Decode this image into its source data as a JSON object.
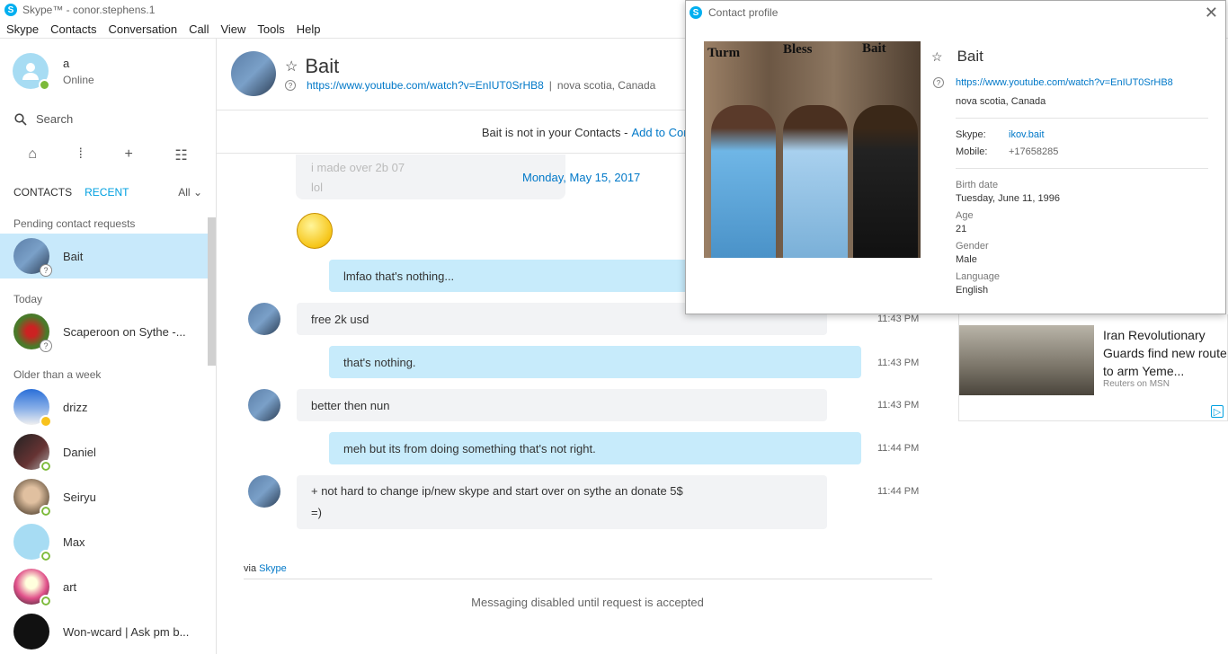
{
  "window": {
    "title": "Skype™ - conor.stephens.1"
  },
  "menu": [
    "Skype",
    "Contacts",
    "Conversation",
    "Call",
    "View",
    "Tools",
    "Help"
  ],
  "me": {
    "name": "a",
    "status": "Online"
  },
  "search": {
    "placeholder": "Search"
  },
  "tabs": {
    "contacts": "CONTACTS",
    "recent": "RECENT",
    "filter": "All"
  },
  "sections": {
    "pending": "Pending contact requests",
    "today": "Today",
    "older": "Older than a week"
  },
  "contacts": [
    {
      "name": "Bait"
    },
    {
      "name": "Scaperoon on Sythe -..."
    },
    {
      "name": "drizz"
    },
    {
      "name": "Daniel"
    },
    {
      "name": "Seiryu"
    },
    {
      "name": "Max"
    },
    {
      "name": "art"
    },
    {
      "name": "Won-wcard | Ask pm b..."
    }
  ],
  "conversation": {
    "name": "Bait",
    "url": "https://www.youtube.com/watch?v=EnIUT0SrHB8",
    "separator": "|",
    "location": "nova scotia, Canada",
    "notice": "Bait is not in your Contacts -",
    "notice_link": "Add to Cont",
    "ghost_lines": [
      "i made over 2b 07",
      "lol"
    ],
    "day": "Monday, May 15, 2017",
    "messages": [
      {
        "text": "lmfao that's nothing...",
        "time": ""
      },
      {
        "text": "free 2k usd",
        "time": "11:43 PM"
      },
      {
        "text": "that's nothing.",
        "time": "11:43 PM"
      },
      {
        "text": "better then nun",
        "time": "11:43 PM"
      },
      {
        "text": "meh but its from doing something that's not right.",
        "time": "11:44 PM"
      },
      {
        "text": "+ not hard to change ip/new skype and start over on sythe an donate 5$",
        "text2": "=)",
        "time": "11:44 PM"
      }
    ],
    "via": "via",
    "via_link": "Skype",
    "disabled": "Messaging disabled until request is accepted"
  },
  "ad": {
    "title": "Iran Revolutionary Guards find new route to arm Yeme...",
    "source": "Reuters on MSN"
  },
  "profile": {
    "title": "Contact profile",
    "photo_labels": [
      "Turm",
      "Bless",
      "Bait"
    ],
    "name": "Bait",
    "url": "https://www.youtube.com/watch?v=EnIUT0SrHB8",
    "location": "nova scotia, Canada",
    "skype_label": "Skype:",
    "skype_value": "ikov.bait",
    "mobile_label": "Mobile:",
    "mobile_value": "+17658285",
    "birth_label": "Birth date",
    "birth_value": "Tuesday, June 11, 1996",
    "age_label": "Age",
    "age_value": "21",
    "gender_label": "Gender",
    "gender_value": "Male",
    "language_label": "Language",
    "language_value": "English"
  }
}
